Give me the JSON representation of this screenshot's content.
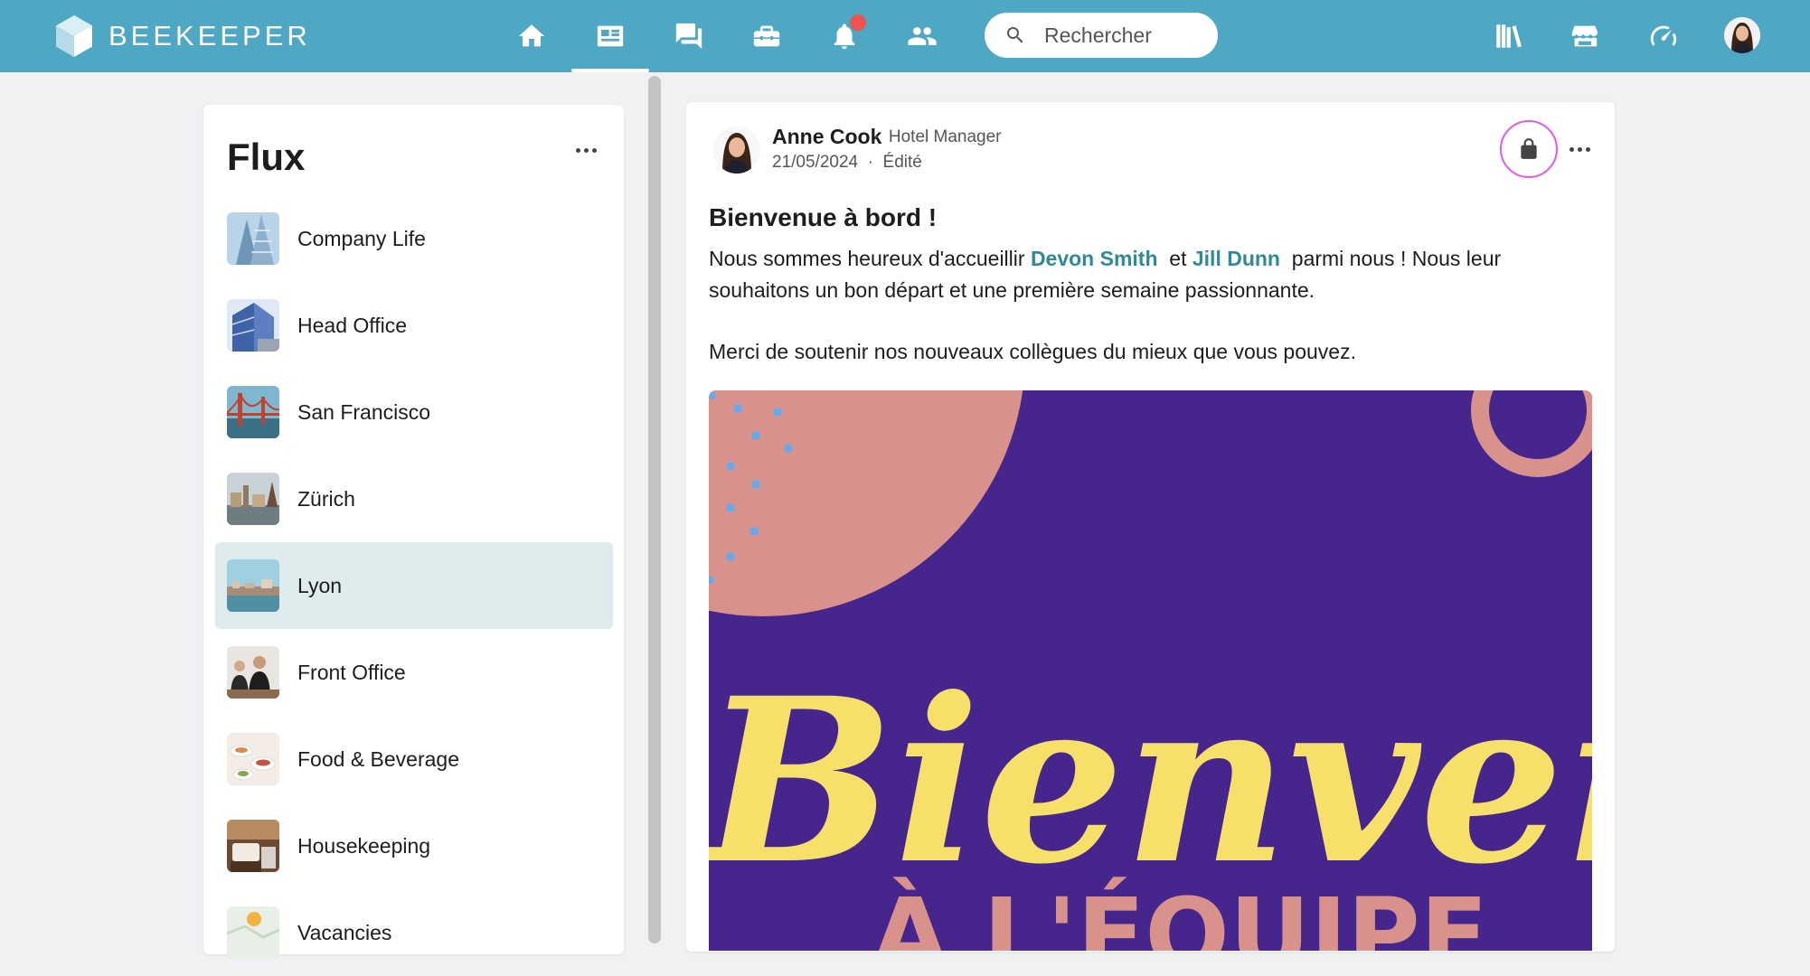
{
  "app": {
    "name": "BEEKEEPER"
  },
  "search": {
    "placeholder": "Rechercher"
  },
  "left_panel": {
    "title": "Flux",
    "streams": [
      {
        "label": "Company Life",
        "active": false
      },
      {
        "label": "Head Office",
        "active": false
      },
      {
        "label": "San Francisco",
        "active": false
      },
      {
        "label": "Zürich",
        "active": false
      },
      {
        "label": "Lyon",
        "active": true
      },
      {
        "label": "Front Office",
        "active": false
      },
      {
        "label": "Food & Beverage",
        "active": false
      },
      {
        "label": "Housekeeping",
        "active": false
      },
      {
        "label": "Vacancies",
        "active": false
      }
    ]
  },
  "post": {
    "author": "Anne Cook",
    "role_separator": "·",
    "role": "Hotel Manager",
    "date": "21/05/2024",
    "edited": "Édité",
    "meta_separator": "·",
    "title": "Bienvenue à bord !",
    "body_prefix": "Nous sommes heureux d'accueillir",
    "mention_1": "Devon Smith",
    "body_connector": "et",
    "mention_2": "Jill Dunn",
    "body_suffix": "parmi nous ! Nous leur souhaitons un bon départ et une première semaine passionnante.",
    "body_paragraph_2": "Merci de soutenir nos nouveaux collègues du mieux que vous pouvez.",
    "image_text_main": "Bienvenu",
    "image_text_sub": "À L'ÉQUIPE"
  },
  "colors": {
    "topbar": "#4ea7c3",
    "accent_mention": "#2d8a96",
    "active_stream": "#deebec",
    "notification": "#ef5350",
    "lock_ring": "#e558e5",
    "image_bg": "#46258c",
    "image_yellow": "#f7e06a",
    "image_pink": "#d8918b"
  }
}
